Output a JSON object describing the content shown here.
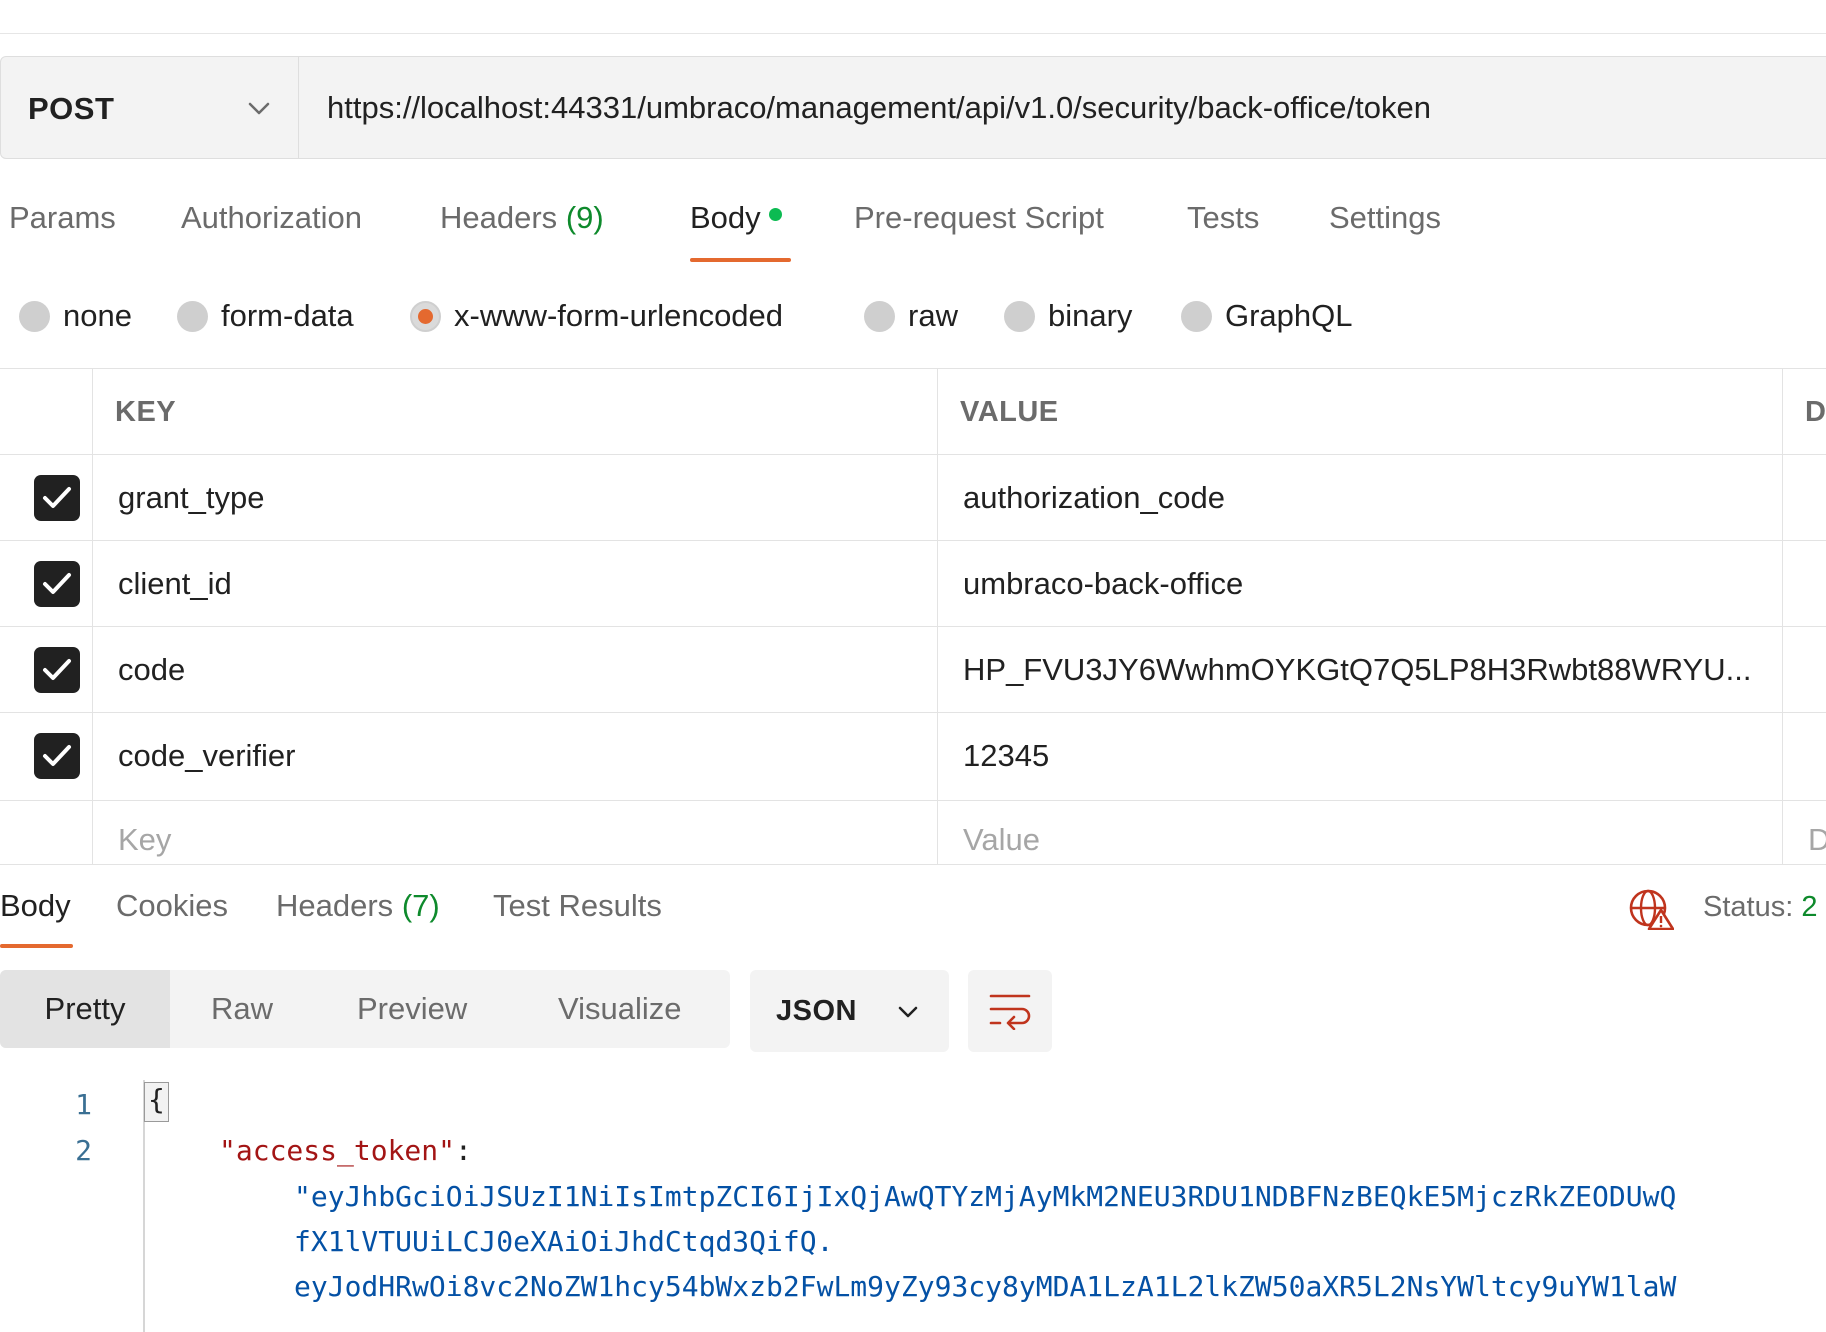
{
  "request": {
    "method": "POST",
    "url": "https://localhost:44331/umbraco/management/api/v1.0/security/back-office/token"
  },
  "request_tabs": {
    "params": "Params",
    "authorization": "Authorization",
    "headers": "Headers",
    "headers_count": "(9)",
    "body": "Body",
    "prerequest": "Pre-request Script",
    "tests": "Tests",
    "settings": "Settings"
  },
  "body_types": {
    "none": "none",
    "form_data": "form-data",
    "urlencoded": "x-www-form-urlencoded",
    "raw": "raw",
    "binary": "binary",
    "graphql": "GraphQL",
    "selected": "x-www-form-urlencoded"
  },
  "table": {
    "headers": {
      "key": "KEY",
      "value": "VALUE",
      "description": "D"
    },
    "rows": [
      {
        "checked": true,
        "key": "grant_type",
        "value": "authorization_code"
      },
      {
        "checked": true,
        "key": "client_id",
        "value": "umbraco-back-office"
      },
      {
        "checked": true,
        "key": "code",
        "value": "HP_FVU3JY6WwhmOYKGtQ7Q5LP8H3Rwbt88WRYU..."
      },
      {
        "checked": true,
        "key": "code_verifier",
        "value": "12345"
      }
    ],
    "placeholder": {
      "key": "Key",
      "value": "Value",
      "description": "D"
    }
  },
  "response_tabs": {
    "body": "Body",
    "cookies": "Cookies",
    "headers": "Headers",
    "headers_count": "(7)",
    "test_results": "Test Results"
  },
  "status": {
    "label": "Status:",
    "value": "2"
  },
  "format": {
    "pretty": "Pretty",
    "raw": "Raw",
    "preview": "Preview",
    "visualize": "Visualize",
    "language": "JSON"
  },
  "code": {
    "line_numbers": [
      "1",
      "2"
    ],
    "open_brace": "{",
    "key": "\"access_token\"",
    "colon": ":",
    "token_lines": [
      "\"eyJhbGciOiJSUzI1NiIsImtpZCI6IjIxQjAwQTYzMjAyMkM2NEU3RDU1NDBFNzBEQkE5MjczRkZEODUwQ",
      "fX1lVTUUiLCJ0eXAiOiJhdCtqd3QifQ.",
      "eyJodHRwOi8vc2NoZW1hcy54bWxzb2FwLm9yZy93cy8yMDA1LzA1L2lkZW50aXR5L2NsYWltcy9uYW1laW"
    ]
  },
  "colors": {
    "accent": "#e4692f",
    "success": "#0cbb52",
    "count_green": "#0e8a2c",
    "json_key": "#a31515",
    "json_string": "#0451a5",
    "error_icon": "#c0341d"
  },
  "icons": {
    "method_chevron": "chevron-down-icon",
    "format_chevron": "chevron-down-icon",
    "wrap": "wrap-lines-icon",
    "network": "globe-warning-icon",
    "checkbox": "checkmark-icon"
  }
}
